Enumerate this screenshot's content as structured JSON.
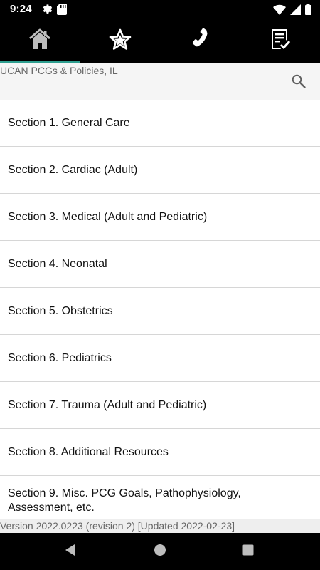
{
  "status_bar": {
    "time": "9:24",
    "icons": [
      "gear-icon",
      "sd-card-icon",
      "wifi-icon",
      "signal-icon",
      "battery-icon"
    ]
  },
  "tabs": [
    {
      "name": "home",
      "icon": "home-icon",
      "selected": true
    },
    {
      "name": "favorites",
      "icon": "star-icon",
      "selected": false
    },
    {
      "name": "contacts",
      "icon": "phone-icon",
      "selected": false
    },
    {
      "name": "checklist",
      "icon": "checklist-icon",
      "selected": false
    }
  ],
  "header": {
    "title": "UCAN PCGs & Policies, IL",
    "search_icon": "search-icon"
  },
  "sections": [
    {
      "label": "Section 1. General Care"
    },
    {
      "label": "Section 2. Cardiac (Adult)"
    },
    {
      "label": "Section 3. Medical (Adult and Pediatric)"
    },
    {
      "label": "Section 4. Neonatal"
    },
    {
      "label": "Section 5. Obstetrics"
    },
    {
      "label": "Section 6. Pediatrics"
    },
    {
      "label": "Section 7. Trauma (Adult and Pediatric)"
    },
    {
      "label": "Section 8. Additional Resources"
    },
    {
      "label": "Section 9. Misc. PCG Goals, Pathophysiology, Assessment, etc."
    }
  ],
  "footer": {
    "version": "Version 2022.0223 (revision 2) [Updated 2022-02-23]"
  },
  "nav_bar": {
    "icons": [
      "back-icon",
      "home-circle-icon",
      "recents-icon"
    ]
  },
  "colors": {
    "tab_indicator": "#2e9e8f",
    "header_background": "#f5f5f5",
    "divider": "#d6d6d6",
    "footer_background": "#eeeeee"
  }
}
